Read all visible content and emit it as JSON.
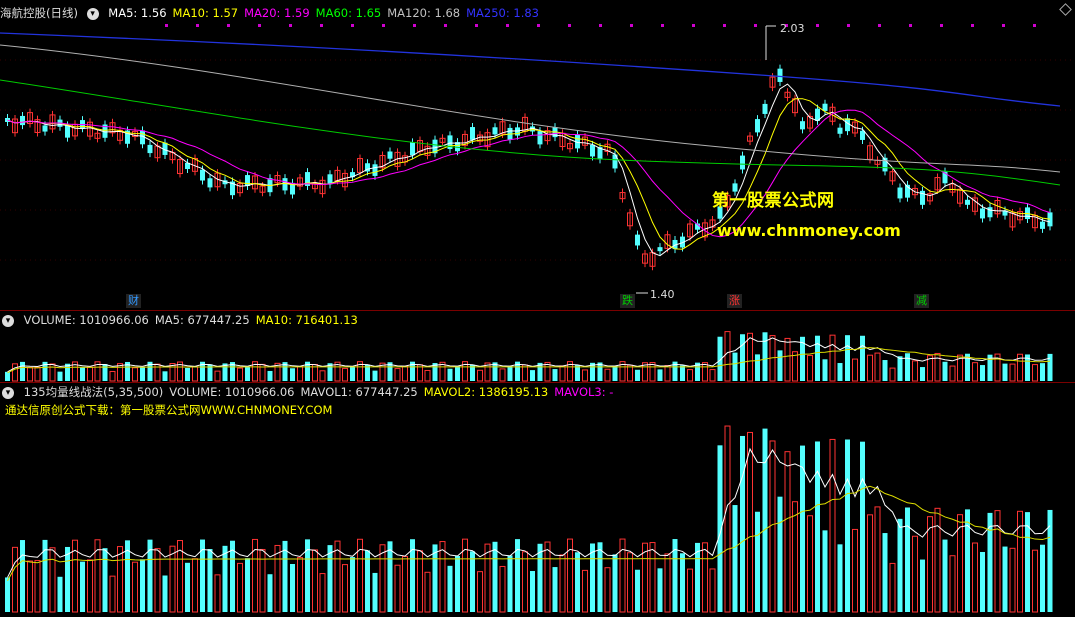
{
  "main": {
    "title": "海航控股(日线)",
    "ma_labels": [
      {
        "text": "MA5: 1.56",
        "color": "#ffffff"
      },
      {
        "text": "MA10: 1.57",
        "color": "#ffff00"
      },
      {
        "text": "MA20: 1.59",
        "color": "#ff00ff"
      },
      {
        "text": "MA60: 1.65",
        "color": "#00ff00"
      },
      {
        "text": "MA120: 1.68",
        "color": "#c0c0c0"
      },
      {
        "text": "MA250: 1.83",
        "color": "#3333ff"
      }
    ],
    "high_label": "2.03",
    "low_label": "1.40",
    "event_tags": [
      {
        "text": "财",
        "color": "#3399ff"
      },
      {
        "text": "跌",
        "color": "#00cc00"
      },
      {
        "text": "涨",
        "color": "#ff3333"
      },
      {
        "text": "减",
        "color": "#00cc00"
      }
    ],
    "watermark_title": "第一股票公式网",
    "watermark_url": "www.chnmoney.com"
  },
  "volume_panel": {
    "labels": [
      {
        "text": "VOLUME: 1010966.06",
        "color": "#dddddd"
      },
      {
        "text": "MA5: 677447.25",
        "color": "#dddddd"
      },
      {
        "text": "MA10: 716401.13",
        "color": "#ffff00"
      }
    ]
  },
  "indicator_panel": {
    "labels": [
      {
        "text": "135均量线战法(5,35,500)",
        "color": "#dddddd"
      },
      {
        "text": "VOLUME: 1010966.06",
        "color": "#dddddd"
      },
      {
        "text": "MAVOL1: 677447.25",
        "color": "#dddddd"
      },
      {
        "text": "MAVOL2: 1386195.13",
        "color": "#ffff00"
      },
      {
        "text": "MAVOL3: -",
        "color": "#ff00ff"
      }
    ],
    "note": "通达信原创公式下载：第一股票公式网WWW.CHNMONEY.COM"
  },
  "colors": {
    "up": "#ff3333",
    "down": "#54ffff",
    "bg": "#000000",
    "separator": "#7a0000"
  }
}
